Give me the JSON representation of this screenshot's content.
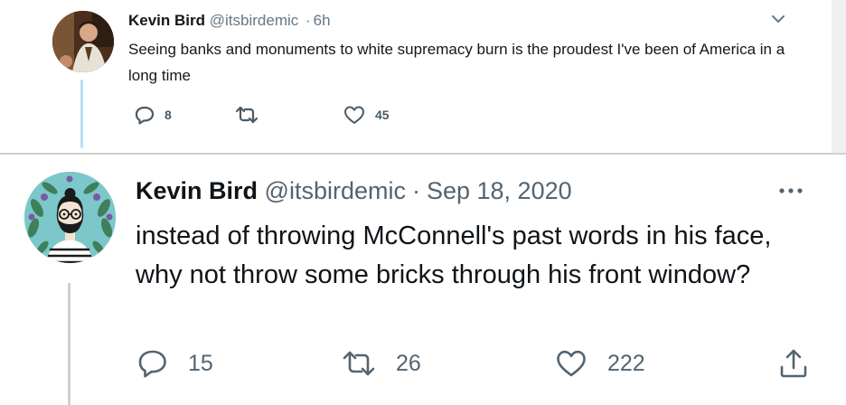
{
  "tweet_top": {
    "avatar": "profile-photo",
    "author_name": "Kevin Bird",
    "author_handle": "@itsbirdemic",
    "separator": "·",
    "timestamp": "6h",
    "menu_icon": "chevron-down-icon",
    "text": "Seeing banks and monuments to white supremacy burn is the proudest I've been of America in a long time",
    "actions": {
      "reply_count": "8",
      "retweet_count": "",
      "like_count": "45"
    }
  },
  "tweet_bottom": {
    "avatar": "illustrated-avatar",
    "author_name": "Kevin Bird",
    "author_handle": "@itsbirdemic",
    "separator": "·",
    "timestamp": "Sep 18, 2020",
    "menu_icon": "more-icon",
    "text": "instead of throwing McConnell's past words in his face, why not throw some bricks through his front window?",
    "actions": {
      "reply_count": "15",
      "retweet_count": "26",
      "like_count": "222",
      "share_icon": "share-icon"
    }
  },
  "colors": {
    "text_primary": "#0f1419",
    "text_secondary": "#536471",
    "thread_line_top": "#b6dff5",
    "thread_line_bottom": "#c9d1d7"
  }
}
